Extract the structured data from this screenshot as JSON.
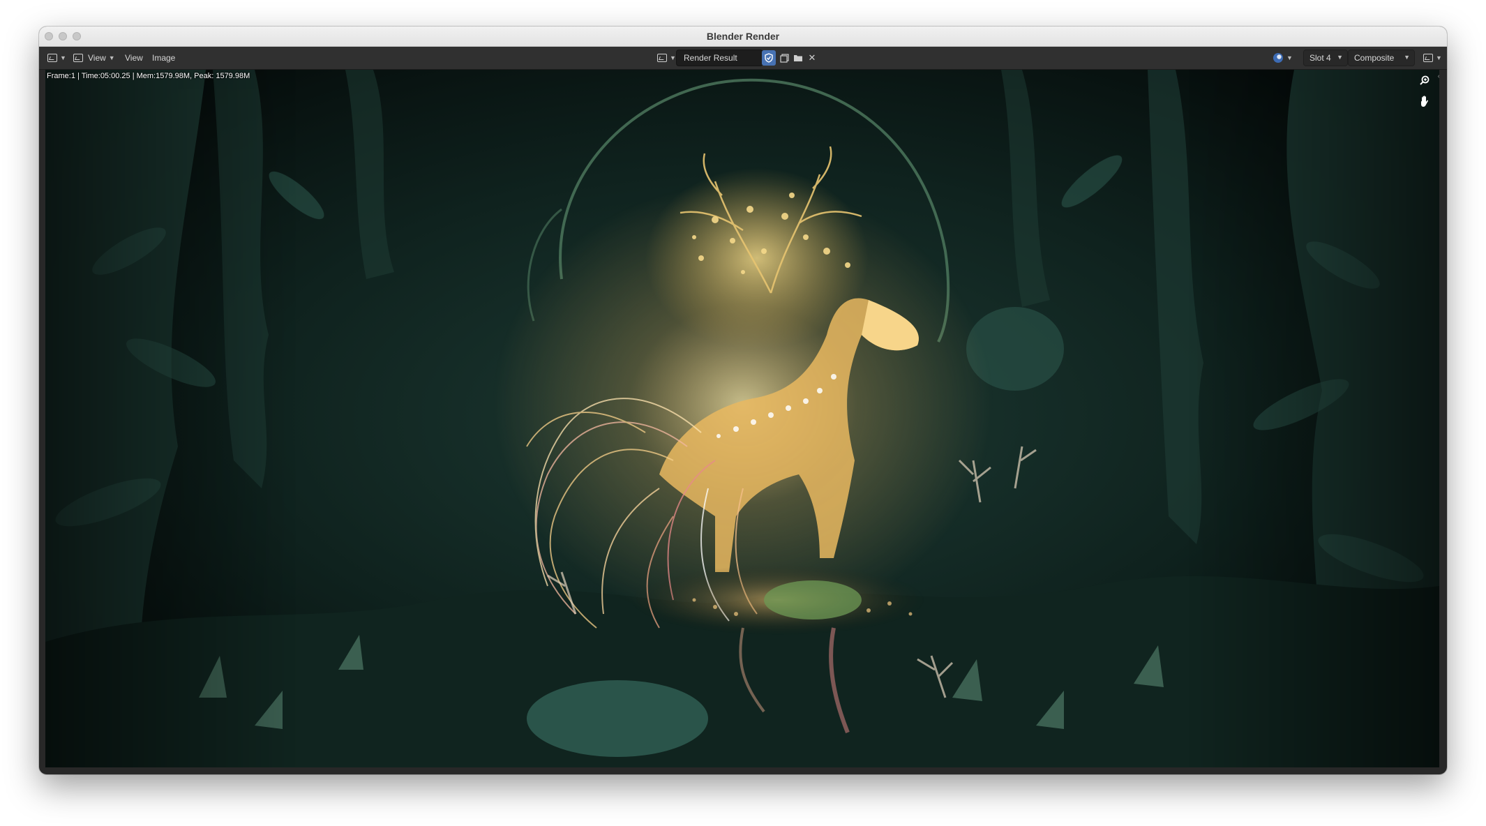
{
  "window": {
    "title": "Blender Render"
  },
  "header": {
    "menu_view_1": "View",
    "menu_view_2": "View",
    "menu_image": "Image",
    "image_name": "Render Result",
    "slot": "Slot 4",
    "layer": "Composite"
  },
  "render": {
    "stats": "Frame:1 | Time:05:00.25 | Mem:1579.98M, Peak: 1579.98M"
  },
  "icons": {
    "editor_type": "image-editor-icon",
    "mode": "image-mode-icon",
    "browse": "browse-image-icon",
    "pin": "pin-shield-icon",
    "new": "new-image-icon",
    "open": "folder-icon",
    "close": "close-icon",
    "channels": "display-channels-icon",
    "gizmo": "gizmo-icon",
    "zoom": "zoom-icon",
    "pan": "hand-pan-icon"
  }
}
